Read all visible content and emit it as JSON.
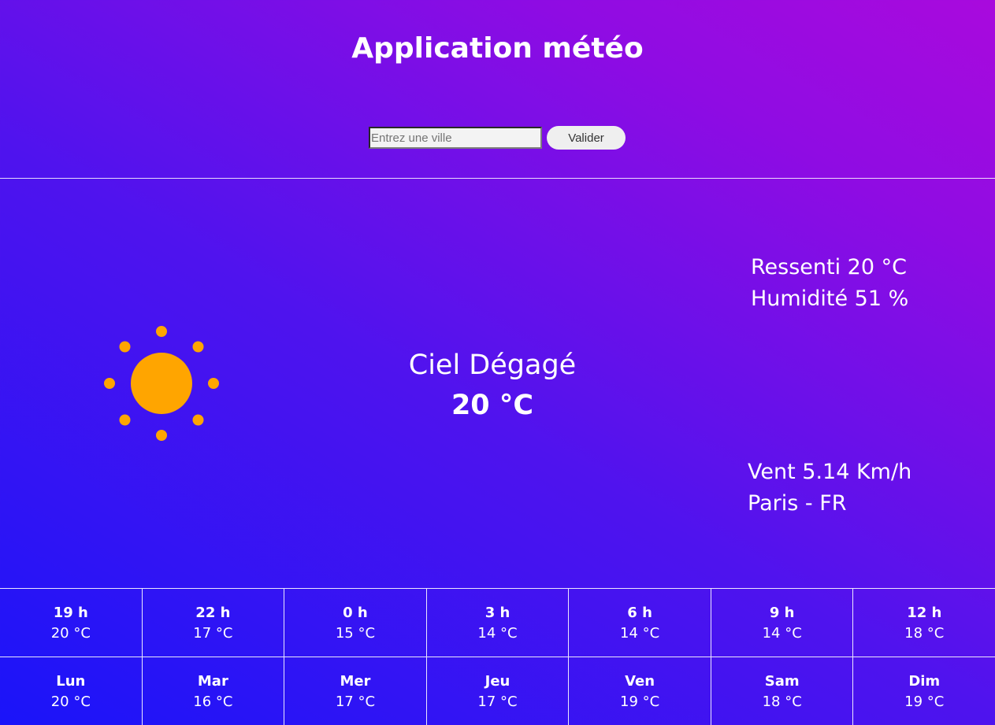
{
  "header": {
    "title": "Application météo"
  },
  "search": {
    "placeholder": "Entrez une ville",
    "value": "",
    "button_label": "Valider"
  },
  "current": {
    "icon": "sun-icon",
    "description": "Ciel Dégagé",
    "temperature": "20 °C",
    "feels_like": "Ressenti 20 °C",
    "humidity": "Humidité 51 %",
    "wind": "Vent 5.14 Km/h",
    "location": "Paris - FR"
  },
  "hourly": [
    {
      "label": "19 h",
      "temp": "20 °C"
    },
    {
      "label": "22 h",
      "temp": "17 °C"
    },
    {
      "label": "0 h",
      "temp": "15 °C"
    },
    {
      "label": "3 h",
      "temp": "14 °C"
    },
    {
      "label": "6 h",
      "temp": "14 °C"
    },
    {
      "label": "9 h",
      "temp": "14 °C"
    },
    {
      "label": "12 h",
      "temp": "18 °C"
    }
  ],
  "daily": [
    {
      "label": "Lun",
      "temp": "20 °C"
    },
    {
      "label": "Mar",
      "temp": "16 °C"
    },
    {
      "label": "Mer",
      "temp": "17 °C"
    },
    {
      "label": "Jeu",
      "temp": "17 °C"
    },
    {
      "label": "Ven",
      "temp": "19 °C"
    },
    {
      "label": "Sam",
      "temp": "18 °C"
    },
    {
      "label": "Dim",
      "temp": "19 °C"
    }
  ],
  "colors": {
    "sun": "#ffa500",
    "gradient_start": "#1a14f9",
    "gradient_end": "#a90add"
  }
}
